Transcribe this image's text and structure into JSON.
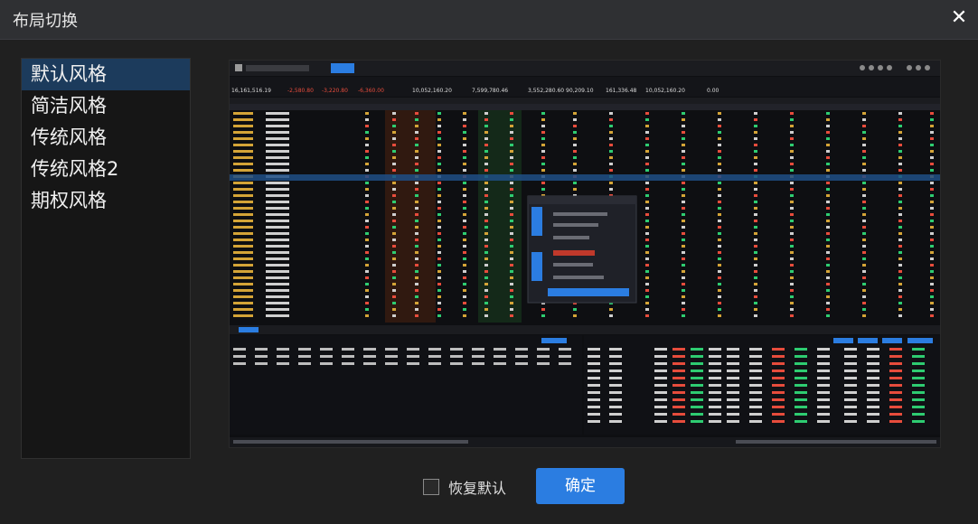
{
  "dialog": {
    "title": "布局切换",
    "close_icon": "close-icon"
  },
  "layouts": [
    {
      "label": "默认风格",
      "selected": true
    },
    {
      "label": "简洁风格",
      "selected": false
    },
    {
      "label": "传统风格",
      "selected": false
    },
    {
      "label": "传统风格2",
      "selected": false
    },
    {
      "label": "期权风格",
      "selected": false
    }
  ],
  "preview": {
    "stat_values": [
      "16,161,516.19",
      "-2,580.80",
      "-3,220.80",
      "-6,360.00",
      "10,052,160.20",
      "7,599,780.46",
      "3,552,280.60",
      "90,209.10",
      "161,336.48",
      "10,052,160.20",
      "0.00"
    ],
    "colors": {
      "header_red": "#e74c3c",
      "header_green": "#27ae60",
      "accent_blue": "#2b7de1",
      "preview_bg": "#0e0f12"
    }
  },
  "footer": {
    "reset_label": "恢复默认",
    "reset_checked": false,
    "ok_label": "确定"
  }
}
